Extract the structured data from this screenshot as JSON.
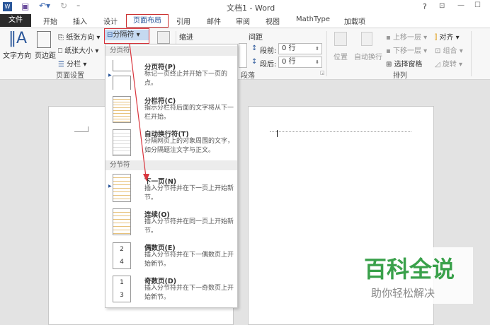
{
  "window": {
    "title": "文档1 - Word",
    "help": "?",
    "controls": [
      "?",
      "⇱",
      "—",
      "☐"
    ]
  },
  "tabs": {
    "file": "文件",
    "items": [
      "开始",
      "插入",
      "设计",
      "页面布局",
      "引用",
      "邮件",
      "审阅",
      "视图",
      "MathType",
      "加载项"
    ],
    "active": "页面布局"
  },
  "ribbon": {
    "text_direction": "文字方向",
    "margins": "页边距",
    "orientation": "纸张方向",
    "size": "纸张大小",
    "columns": "分栏",
    "page_setup": "页面设置",
    "breaks": "分隔符",
    "indent": "缩进",
    "spacing": "间距",
    "before_label": "段前:",
    "before_value": "0 行",
    "after_label": "段后:",
    "after_value": "0 行",
    "paragraph": "段落",
    "position": "位置",
    "wrap": "自动换行",
    "bring_forward": "上移一层",
    "send_backward": "下移一层",
    "selection_pane": "选择窗格",
    "align": "对齐",
    "group": "组合",
    "rotate": "旋转",
    "arrange": "排列"
  },
  "breaks_menu": {
    "page_breaks_header": "分页符",
    "section_breaks_header": "分节符",
    "items": [
      {
        "title": "分页符(P)",
        "desc": "标记一页终止并开始下一页的点。"
      },
      {
        "title": "分栏符(C)",
        "desc": "指示分栏符后面的文字将从下一栏开始。"
      },
      {
        "title": "自动换行符(T)",
        "desc": "分隔网页上的对象周围的文字，如分隔题注文字与正文。"
      },
      {
        "title": "下一页(N)",
        "desc": "插入分节符并在下一页上开始新节。"
      },
      {
        "title": "连续(O)",
        "desc": "插入分节符并在同一页上开始新节。"
      },
      {
        "title": "偶数页(E)",
        "desc": "插入分节符并在下一偶数页上开始新节。"
      },
      {
        "title": "奇数页(D)",
        "desc": "插入分节符并在下一奇数页上开始新节。"
      }
    ]
  },
  "watermark": {
    "brand": "百科全说",
    "slogan": "助你轻松解决"
  },
  "colors": {
    "accent": "#2b579a",
    "highlight": "#c5d9f1",
    "annotation": "#d9363e",
    "file_tab": "#2b2b2b"
  }
}
